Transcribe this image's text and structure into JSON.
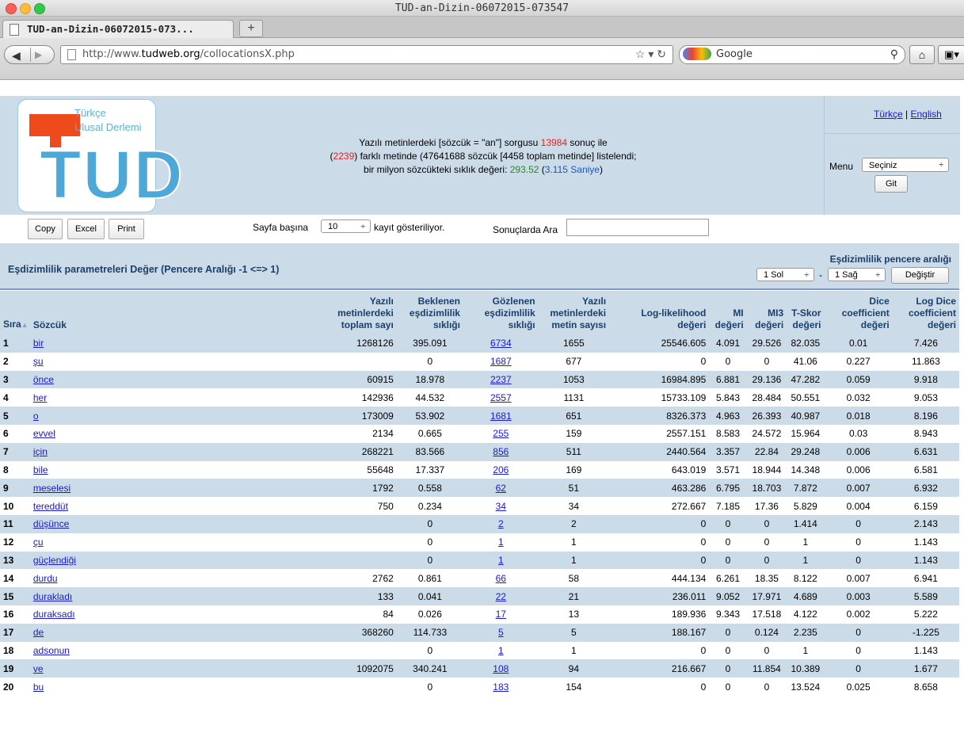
{
  "browser": {
    "window_title": "TUD-an-Dizin-06072015-073547",
    "tab_title": "TUD-an-Dizin-06072015-073...",
    "new_tab": "+",
    "url_prefix": "http://www.",
    "url_domain": "tudweb.org",
    "url_path": "/collocationsX.php",
    "search_placeholder": "Google"
  },
  "logo": {
    "line1": "Türkçe",
    "line2": "Ulusal Derlemi",
    "letters": "TUD"
  },
  "header": {
    "l1_a": "Yazılı metinlerdeki [sözcük = \"an\"] sorgusu ",
    "l1_count": "13984",
    "l1_b": " sonuç ile",
    "l2_a": "(",
    "l2_docs": "2239",
    "l2_b": ") farklı metinde (47641688 sözcük [4458 toplam metinde] listelendi;",
    "l3_a": "bir milyon sözcükteki sıklık değeri: ",
    "l3_freq": "293.52",
    "l3_b": " (",
    "l3_time": "3.115 Saniye",
    "l3_c": ")"
  },
  "right_panel": {
    "lang_tr": "Türkçe",
    "lang_sep": "|",
    "lang_en": "English",
    "menu_label": "Menu",
    "menu_value": "Seçiniz",
    "go_label": "Git"
  },
  "toolbar": {
    "copy": "Copy",
    "excel": "Excel",
    "print": "Print",
    "pagesize_label": "Sayfa başına",
    "pagesize_value": "10",
    "pagesize_after": "kayıt gösteriliyor.",
    "search_label": "Sonuçlarda Ara",
    "search_value": ""
  },
  "section": {
    "title": "Eşdizimlilik parametreleri Değer (Pencere Aralığı -1 <=> 1)",
    "window_label": "Eşdizimlilik pencere aralığı",
    "left_value": "1 Sol",
    "dash": "-",
    "right_value": "1 Sağ",
    "change_label": "Değiştir"
  },
  "table": {
    "headers": {
      "rank": "Sıra",
      "word": "Sözcük",
      "total_l1": "Yazılı",
      "total_l2": "metinlerdeki",
      "total_l3": "toplam sayı",
      "expected_l1": "Beklenen",
      "expected_l2": "eşdizimlilik",
      "expected_l3": "sıklığı",
      "observed_l1": "Gözlenen",
      "observed_l2": "eşdizimlilik",
      "observed_l3": "sıklığı",
      "textcount_l1": "Yazılı",
      "textcount_l2": "metinlerdeki",
      "textcount_l3": "metin sayısı",
      "ll_l1": "Log-likelihood",
      "ll_l2": "değeri",
      "mi_l1": "MI",
      "mi_l2": "değeri",
      "mi3_l1": "MI3",
      "mi3_l2": "değeri",
      "t_l1": "T-Skor",
      "t_l2": "değeri",
      "dice_l1": "Dice",
      "dice_l2": "coefficient",
      "dice_l3": "değeri",
      "logdice_l1": "Log Dice",
      "logdice_l2": "coefficient",
      "logdice_l3": "değeri"
    },
    "rows": [
      {
        "rank": "1",
        "word": "bir",
        "total": "1268126",
        "expected": "395.091",
        "observed": "6734",
        "texts": "1655",
        "ll": "25546.605",
        "mi": "4.091",
        "mi3": "29.526",
        "t": "82.035",
        "dice": "0.01",
        "logdice": "7.426"
      },
      {
        "rank": "2",
        "word": "şu",
        "total": "",
        "expected": "0",
        "observed": "1687",
        "texts": "677",
        "ll": "0",
        "mi": "0",
        "mi3": "0",
        "t": "41.06",
        "dice": "0.227",
        "logdice": "11.863"
      },
      {
        "rank": "3",
        "word": "önce",
        "total": "60915",
        "expected": "18.978",
        "observed": "2237",
        "texts": "1053",
        "ll": "16984.895",
        "mi": "6.881",
        "mi3": "29.136",
        "t": "47.282",
        "dice": "0.059",
        "logdice": "9.918"
      },
      {
        "rank": "4",
        "word": "her",
        "total": "142936",
        "expected": "44.532",
        "observed": "2557",
        "texts": "1131",
        "ll": "15733.109",
        "mi": "5.843",
        "mi3": "28.484",
        "t": "50.551",
        "dice": "0.032",
        "logdice": "9.053"
      },
      {
        "rank": "5",
        "word": "o",
        "total": "173009",
        "expected": "53.902",
        "observed": "1681",
        "texts": "651",
        "ll": "8326.373",
        "mi": "4.963",
        "mi3": "26.393",
        "t": "40.987",
        "dice": "0.018",
        "logdice": "8.196"
      },
      {
        "rank": "6",
        "word": "evvel",
        "total": "2134",
        "expected": "0.665",
        "observed": "255",
        "texts": "159",
        "ll": "2557.151",
        "mi": "8.583",
        "mi3": "24.572",
        "t": "15.964",
        "dice": "0.03",
        "logdice": "8.943"
      },
      {
        "rank": "7",
        "word": "için",
        "total": "268221",
        "expected": "83.566",
        "observed": "856",
        "texts": "511",
        "ll": "2440.564",
        "mi": "3.357",
        "mi3": "22.84",
        "t": "29.248",
        "dice": "0.006",
        "logdice": "6.631"
      },
      {
        "rank": "8",
        "word": "bile",
        "total": "55648",
        "expected": "17.337",
        "observed": "206",
        "texts": "169",
        "ll": "643.019",
        "mi": "3.571",
        "mi3": "18.944",
        "t": "14.348",
        "dice": "0.006",
        "logdice": "6.581"
      },
      {
        "rank": "9",
        "word": "meselesi",
        "total": "1792",
        "expected": "0.558",
        "observed": "62",
        "texts": "51",
        "ll": "463.286",
        "mi": "6.795",
        "mi3": "18.703",
        "t": "7.872",
        "dice": "0.007",
        "logdice": "6.932"
      },
      {
        "rank": "10",
        "word": "tereddüt",
        "total": "750",
        "expected": "0.234",
        "observed": "34",
        "texts": "34",
        "ll": "272.667",
        "mi": "7.185",
        "mi3": "17.36",
        "t": "5.829",
        "dice": "0.004",
        "logdice": "6.159"
      },
      {
        "rank": "11",
        "word": "düşünce",
        "total": "",
        "expected": "0",
        "observed": "2",
        "texts": "2",
        "ll": "0",
        "mi": "0",
        "mi3": "0",
        "t": "1.414",
        "dice": "0",
        "logdice": "2.143"
      },
      {
        "rank": "12",
        "word": "çu",
        "total": "",
        "expected": "0",
        "observed": "1",
        "texts": "1",
        "ll": "0",
        "mi": "0",
        "mi3": "0",
        "t": "1",
        "dice": "0",
        "logdice": "1.143"
      },
      {
        "rank": "13",
        "word": "güçlendiği",
        "total": "",
        "expected": "0",
        "observed": "1",
        "texts": "1",
        "ll": "0",
        "mi": "0",
        "mi3": "0",
        "t": "1",
        "dice": "0",
        "logdice": "1.143"
      },
      {
        "rank": "14",
        "word": "durdu",
        "total": "2762",
        "expected": "0.861",
        "observed": "66",
        "texts": "58",
        "ll": "444.134",
        "mi": "6.261",
        "mi3": "18.35",
        "t": "8.122",
        "dice": "0.007",
        "logdice": "6.941"
      },
      {
        "rank": "15",
        "word": "durakladı",
        "total": "133",
        "expected": "0.041",
        "observed": "22",
        "texts": "21",
        "ll": "236.011",
        "mi": "9.052",
        "mi3": "17.971",
        "t": "4.689",
        "dice": "0.003",
        "logdice": "5.589"
      },
      {
        "rank": "16",
        "word": "duraksadı",
        "total": "84",
        "expected": "0.026",
        "observed": "17",
        "texts": "13",
        "ll": "189.936",
        "mi": "9.343",
        "mi3": "17.518",
        "t": "4.122",
        "dice": "0.002",
        "logdice": "5.222"
      },
      {
        "rank": "17",
        "word": "de",
        "total": "368260",
        "expected": "114.733",
        "observed": "5",
        "texts": "5",
        "ll": "188.167",
        "mi": "0",
        "mi3": "0.124",
        "t": "2.235",
        "dice": "0",
        "logdice": "-1.225"
      },
      {
        "rank": "18",
        "word": "adsonun",
        "total": "",
        "expected": "0",
        "observed": "1",
        "texts": "1",
        "ll": "0",
        "mi": "0",
        "mi3": "0",
        "t": "1",
        "dice": "0",
        "logdice": "1.143"
      },
      {
        "rank": "19",
        "word": "ve",
        "total": "1092075",
        "expected": "340.241",
        "observed": "108",
        "texts": "94",
        "ll": "216.667",
        "mi": "0",
        "mi3": "11.854",
        "t": "10.389",
        "dice": "0",
        "logdice": "1.677"
      },
      {
        "rank": "20",
        "word": "bu",
        "total": "",
        "expected": "0",
        "observed": "183",
        "texts": "154",
        "ll": "0",
        "mi": "0",
        "mi3": "0",
        "t": "13.524",
        "dice": "0.025",
        "logdice": "8.658"
      }
    ]
  }
}
